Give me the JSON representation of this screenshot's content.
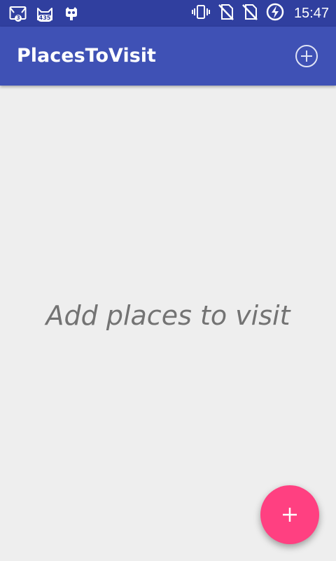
{
  "status_bar": {
    "notifications": [
      {
        "icon": "mail-app-icon",
        "badge": "3"
      },
      {
        "icon": "cat-app-icon",
        "badge": "435"
      },
      {
        "icon": "cyanogen-icon",
        "badge": ""
      }
    ],
    "system_icons": [
      "vibrate-icon",
      "no-sim-icon",
      "no-sim-icon",
      "battery-charging-icon"
    ],
    "time": "15:47"
  },
  "app_bar": {
    "title": "PlacesToVisit",
    "action_icon": "add-circle-icon"
  },
  "main": {
    "empty_message": "Add places to visit"
  },
  "fab": {
    "icon": "plus-icon"
  },
  "colors": {
    "status_bar": "#303f9f",
    "primary": "#3f51b5",
    "accent": "#ff4081",
    "background": "#eeeeee",
    "empty_text": "#737373"
  }
}
